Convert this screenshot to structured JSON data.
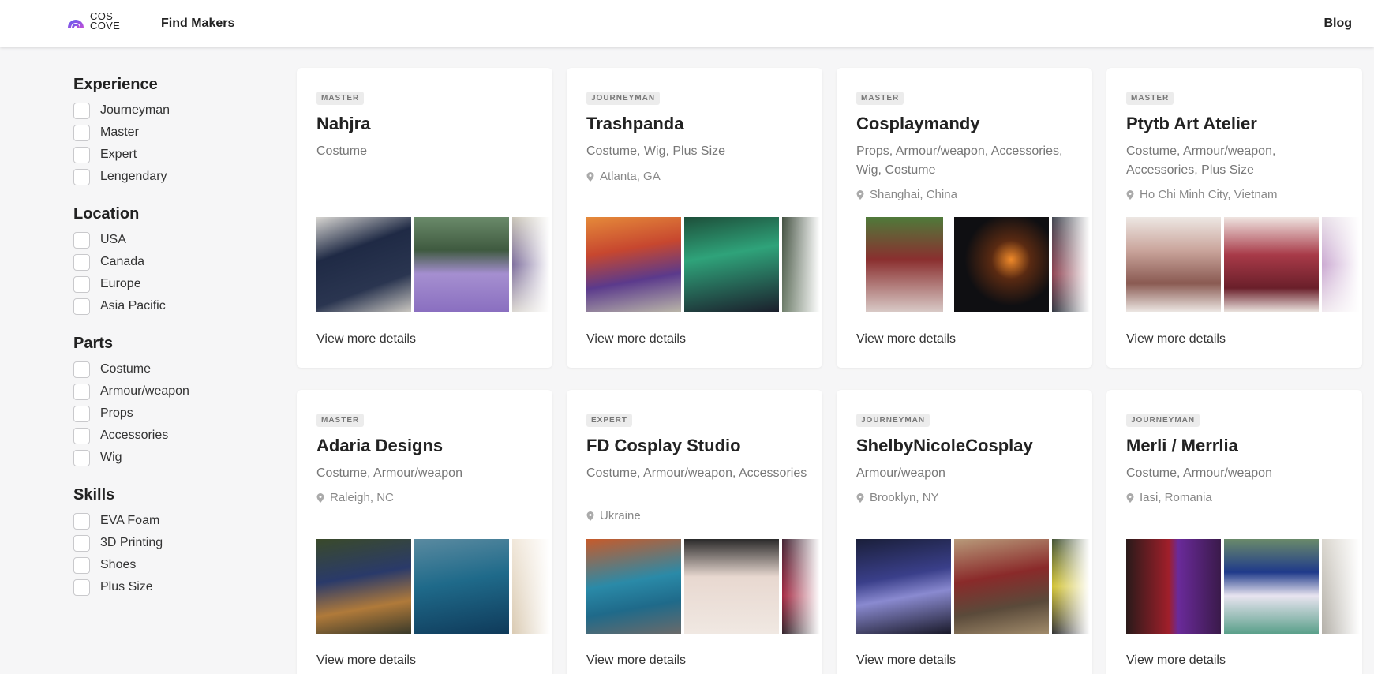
{
  "header": {
    "logo_line1": "COS",
    "logo_line2": "COVE",
    "nav_find": "Find Makers",
    "nav_blog": "Blog",
    "brand_color": "#7b5cf0"
  },
  "filters": [
    {
      "title": "Experience",
      "options": [
        "Journeyman",
        "Master",
        "Expert",
        "Lengendary"
      ]
    },
    {
      "title": "Location",
      "options": [
        "USA",
        "Canada",
        "Europe",
        "Asia Pacific"
      ]
    },
    {
      "title": "Parts",
      "options": [
        "Costume",
        "Armour/weapon",
        "Props",
        "Accessories",
        "Wig"
      ]
    },
    {
      "title": "Skills",
      "options": [
        "EVA Foam",
        "3D Printing",
        "Shoes",
        "Plus Size"
      ]
    }
  ],
  "cards": [
    {
      "level": "MASTER",
      "name": "Nahjra",
      "parts": "Costume",
      "location": "",
      "link": "View more details"
    },
    {
      "level": "JOURNEYMAN",
      "name": "Trashpanda",
      "parts": "Costume, Wig, Plus Size",
      "location": "Atlanta, GA",
      "link": "View more details"
    },
    {
      "level": "MASTER",
      "name": "Cosplaymandy",
      "parts": "Props, Armour/weapon, Accessories, Wig, Costume",
      "location": "Shanghai, China",
      "link": "View more details"
    },
    {
      "level": "MASTER",
      "name": "Ptytb Art Atelier",
      "parts": "Costume, Armour/weapon, Accessories, Plus Size",
      "location": "Ho Chi Minh City, Vietnam",
      "link": "View more details"
    },
    {
      "level": "MASTER",
      "name": "Adaria Designs",
      "parts": "Costume, Armour/weapon",
      "location": "Raleigh, NC",
      "link": "View more details"
    },
    {
      "level": "EXPERT",
      "name": "FD Cosplay Studio",
      "parts": "Costume, Armour/weapon, Accessories",
      "location": "Ukraine",
      "link": "View more details"
    },
    {
      "level": "JOURNEYMAN",
      "name": "ShelbyNicoleCosplay",
      "parts": "Armour/weapon",
      "location": "Brooklyn, NY",
      "link": "View more details"
    },
    {
      "level": "JOURNEYMAN",
      "name": "Merli / Merrlia",
      "parts": "Costume, Armour/weapon",
      "location": "Iasi, Romania",
      "link": "View more details"
    }
  ]
}
